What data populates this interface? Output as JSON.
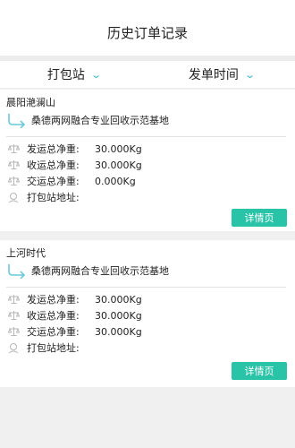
{
  "header": {
    "title": "历史订单记录"
  },
  "filters": [
    {
      "label": "打包站"
    },
    {
      "label": "发单时间"
    }
  ],
  "orders": [
    {
      "site": "晨阳滟澜山",
      "base": "桑德两网融合专业回收示范基地",
      "rows": [
        {
          "label": "发运总净重:",
          "value": "30.000Kg",
          "icon": "scale-icon"
        },
        {
          "label": "收运总净重:",
          "value": "30.000Kg",
          "icon": "scale-icon"
        },
        {
          "label": "交运总净重:",
          "value": "0.000Kg",
          "icon": "scale-icon"
        },
        {
          "label": "打包站地址:",
          "value": "",
          "icon": "location-icon"
        }
      ],
      "button": "详情页"
    },
    {
      "site": "上河时代",
      "base": "桑德两网融合专业回收示范基地",
      "rows": [
        {
          "label": "发运总净重:",
          "value": "30.000Kg",
          "icon": "scale-icon"
        },
        {
          "label": "收运总净重:",
          "value": "30.000Kg",
          "icon": "scale-icon"
        },
        {
          "label": "交运总净重:",
          "value": "30.000Kg",
          "icon": "scale-icon"
        },
        {
          "label": "打包站地址:",
          "value": "",
          "icon": "location-icon"
        }
      ],
      "button": "详情页"
    }
  ],
  "colors": {
    "accent": "#29c3a8",
    "chevron": "#3ab5c7",
    "route_arrow": "#6cc8d8",
    "icon_gray": "#b7b7b7"
  }
}
